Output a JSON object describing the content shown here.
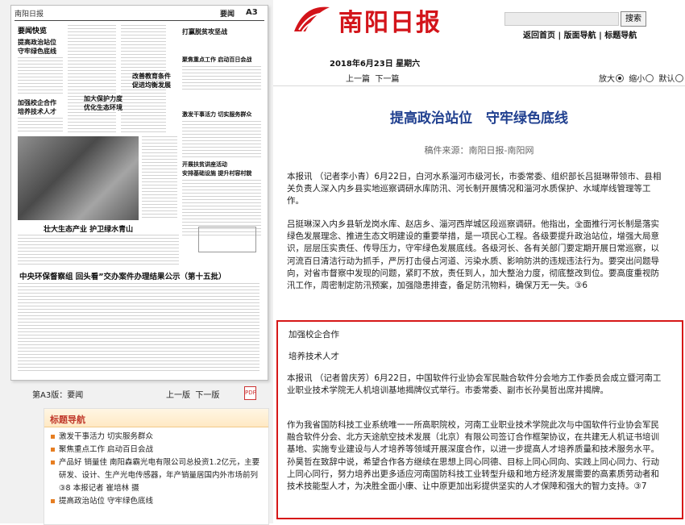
{
  "thumbnail": {
    "masthead": "南阳日报",
    "section": "要闻",
    "page": "A3",
    "kuaixun": "要闻快览",
    "headlines": {
      "h1": "提高政治站位",
      "h1b": "守牢绿色底线",
      "h2": "打赢脱贫攻坚战",
      "h3": "聚焦重点工作 启动百日会战",
      "h4": "改善教育条件",
      "h4b": "促进均衡发展",
      "h5": "加大保护力度",
      "h5b": "优化生态环境",
      "h6": "加强校企合作",
      "h6b": "培养技术人才",
      "h7": "激发干事活力 切实服务群众",
      "h8": "开展扶贫讲座活动",
      "h9": "安排基础设施 提升村容村貌",
      "photo_caption": "壮大生态产业 护卫绿水青山",
      "bottom": "中央环保督察组 回头看”交办案件办理结果公示（第十五批）"
    }
  },
  "page_bar": {
    "label": "第A3版：要闻",
    "prev": "上一版",
    "next": "下一版",
    "pdf_icon": "PDF"
  },
  "toc": {
    "title": "标题导航",
    "items": [
      "激发干事活力 切实服务群众",
      "聚焦重点工作 启动百日会战",
      "产品好 销量佳 南阳森霸光电有限公司总投资1.2亿元，主要研发、设计、生产光电传感器，年产销量居国内外市场前列 ③8 本报记者 崔培林 摄",
      "提高政治站位 守牢绿色底线"
    ]
  },
  "header": {
    "logo": "南阳日报",
    "search_button": "搜索",
    "nav": "返回首页 | 版面导航 | 标题导航",
    "date": "2018年6月23日 星期六",
    "prev_article": "上一篇",
    "next_article": "下一篇",
    "zoom_in": "放大",
    "zoom_out": "缩小",
    "zoom_default": "默认"
  },
  "article": {
    "title": "提高政治站位　守牢绿色底线",
    "source": "稿件来源：南阳日报-南阳网",
    "p1": "本报讯 （记者李小青）6月22日，白河水系淄河市级河长，市委常委、组织部长吕挺琳带领市、县相关负责人深入内乡县实地巡察调研水库防汛、河长制开展情况和淄河水质保护、水域岸线管理等工作。",
    "p2": "吕挺琳深入内乡县斩龙岗水库、赵店乡、淄河西岸城区段巡察调研。他指出，全面推行河长制是落实绿色发展理念、推进生态文明建设的重要举措，是一项民心工程。各级要提升政治站位，增强大局意识，层层压实责任、传导压力，守牢绿色发展底线。各级河长、各有关部门要定期开展日常巡察，以河流百日清洁行动为抓手，严厉打击侵占河道、污染水质、影响防洪的违规违法行为。要突出问题导向，对省市督察中发现的问题，紧盯不放，责任到人，加大整治力度，彻底整改到位。要高度重视防汛工作，周密制定防汛预案，加强隐患排查，备足防汛物料，确保万无一失。③6"
  },
  "highlight": {
    "title1": "加强校企合作",
    "title2": "培养技术人才",
    "p1": "本报讯 （记者曾庆芳）6月22日，中国软件行业协会军民融合软件分会地方工作委员会成立暨河南工业职业技术学院无人机培训基地揭牌仪式举行。市委常委、副市长孙昊哲出席并揭牌。",
    "p2": "作为我省国防科技工业系统唯一一所高职院校，河南工业职业技术学院此次与中国软件行业协会军民融合软件分会、北方天途航空技术发展（北京）有限公司签订合作框架协议，在共建无人机证书培训基地、实施专业建设与人才培养等领域开展深度合作，以进一步提高人才培养质量和技术服务水平。孙昊哲在致辞中说，希望合作各方继续在思想上同心同德、目标上同心同向、实践上同心同力、行动上同心同行，努力培养出更多适应河南国防科技工业转型升级和地方经济发展需要的高素质劳动者和技术技能型人才，为决胜全面小康、让中原更加出彩提供坚实的人才保障和强大的智力支持。③7"
  },
  "colors": {
    "logo_red": "#d3141a",
    "title_blue": "#1f3f8f",
    "highlight_border": "#d61818",
    "toc_accent": "#e67e22"
  }
}
